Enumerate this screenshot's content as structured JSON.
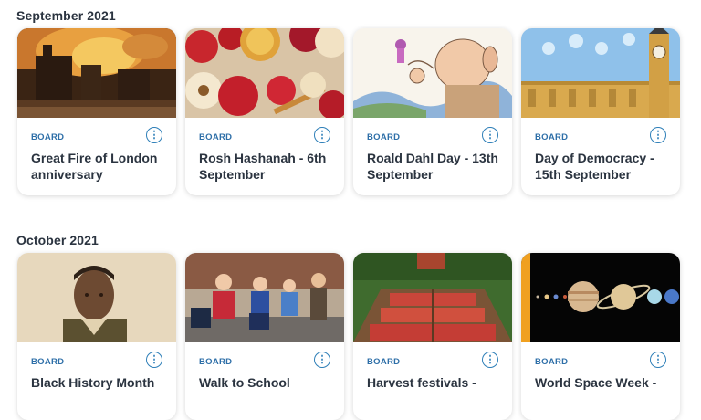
{
  "sections": [
    {
      "title": "September 2021",
      "cards": [
        {
          "type": "BOARD",
          "title": "Great Fire of London anniversary",
          "image": "great-fire-painting"
        },
        {
          "type": "BOARD",
          "title": "Rosh Hashanah - 6th September",
          "image": "apples-honey-pomegranate"
        },
        {
          "type": "BOARD",
          "title": "Roald Dahl Day - 13th September",
          "image": "bfg-illustration"
        },
        {
          "type": "BOARD",
          "title": "Day of Democracy - 15th September",
          "image": "houses-of-parliament"
        }
      ]
    },
    {
      "title": "October 2021",
      "cards": [
        {
          "type": "BOARD",
          "title": "Black History Month",
          "image": "soldier-portrait"
        },
        {
          "type": "BOARD",
          "title": "Walk to School",
          "image": "children-walking"
        },
        {
          "type": "BOARD",
          "title": "Harvest festivals -",
          "image": "apple-crates"
        },
        {
          "type": "BOARD",
          "title": "World Space Week -",
          "image": "solar-system"
        }
      ]
    }
  ],
  "more_icon": "more-vertical-icon"
}
